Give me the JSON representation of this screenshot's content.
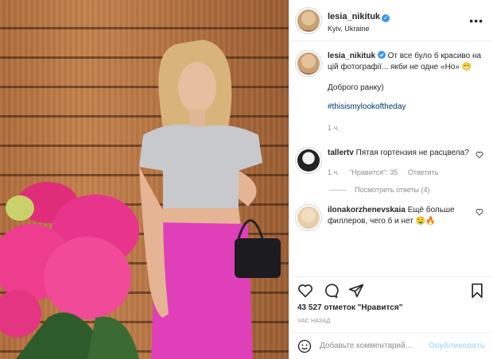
{
  "post": {
    "username": "lesia_nikituk",
    "location": "Kyiv, Ukraine",
    "caption_line1": "От все було б красиво на цій фотографії... якби не одне «Но» 😬",
    "caption_line2": "Доброго ранку)",
    "hashtag": "#thisismylookoftheday",
    "caption_time": "1 ч."
  },
  "comments": [
    {
      "username": "tallertv",
      "text": "Пятая гортензия не расцвела?",
      "time": "1 ч.",
      "likes": "\"Нравится\": 35",
      "reply": "Ответить"
    },
    {
      "username": "ilonakorzhenevskaia",
      "text": "Ещё больше филлеров, чего б и нет 🤤🔥"
    }
  ],
  "view_replies": "Посмотреть ответы (4)",
  "likes_count": "43 527 отметок \"Нравится\"",
  "timestamp": "ЧАС НАЗАД",
  "comment_box": {
    "placeholder": "Добавьте комментарий...",
    "publish": "Опубликовать"
  },
  "colors": {
    "link": "#00376b",
    "verified": "#3897f0",
    "publish": "#b2dffc"
  }
}
